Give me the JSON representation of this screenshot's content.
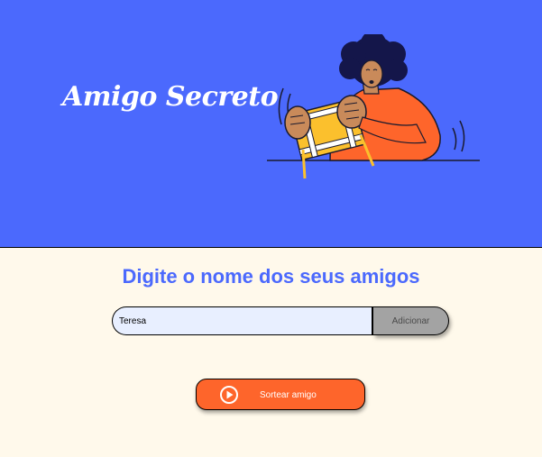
{
  "header": {
    "title": "Amigo Secreto",
    "illustration_icon": "person-holding-gift-box-illustration",
    "background_color": "#4b69fd"
  },
  "main": {
    "heading": "Digite o nome dos seus amigos",
    "name_input": {
      "value": "Teresa",
      "placeholder": ""
    },
    "add_button_label": "Adicionar",
    "draw_button": {
      "label": "Sortear amigo",
      "icon": "play-circle-icon",
      "color": "#fe652b"
    },
    "background_color": "#fff9eb",
    "accent_color": "#4b69fd"
  }
}
